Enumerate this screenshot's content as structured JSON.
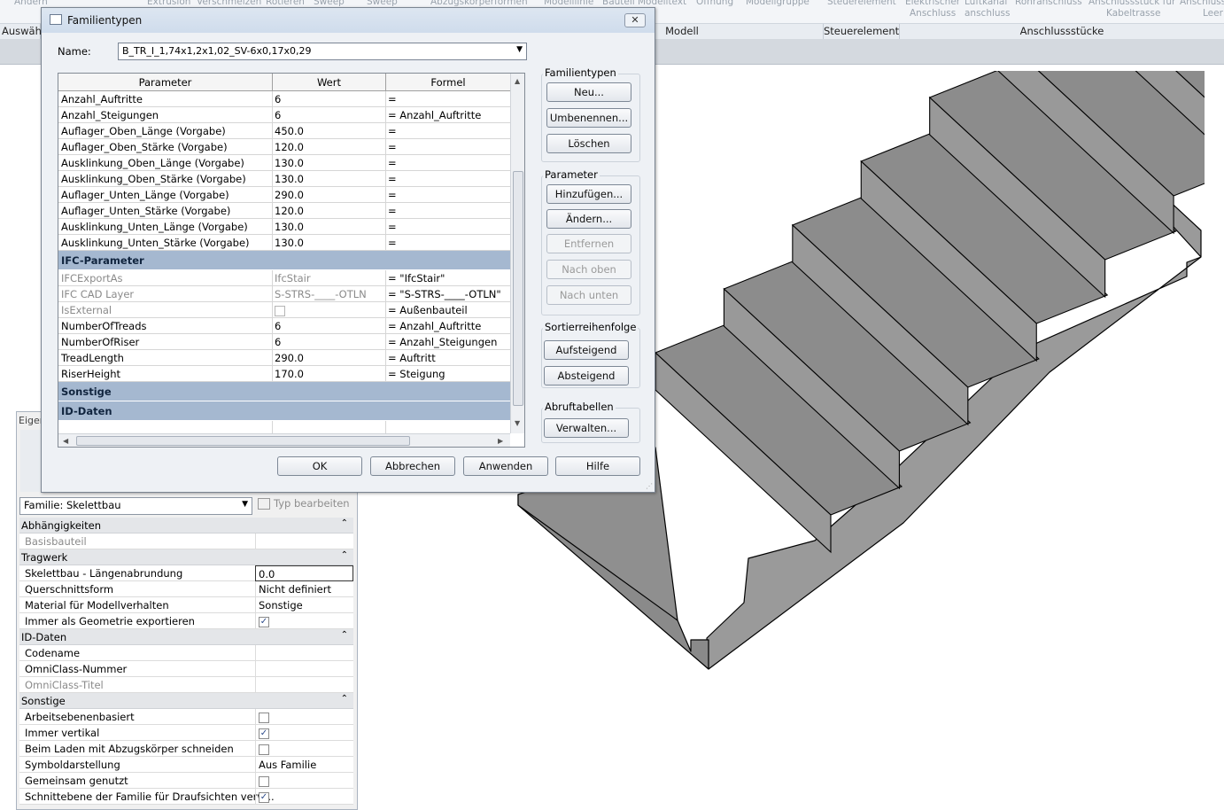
{
  "ribbon": {
    "top_items": [
      "Ändern",
      "Extrusion",
      "Verschmelzen",
      "Rotieren",
      "Sweep",
      "Sweep",
      "Abzugskörperformen",
      "Modelllinie",
      "Bauteil",
      "Modelltext",
      "Öffnung",
      "Modellgruppe",
      "Steuerelement",
      "Elektrischer",
      "Luftkanal",
      "Rohranschluss",
      "Anschlussstück für",
      "Anschluss",
      "Leer"
    ],
    "second_items": [
      "Anschluss",
      "anschluss",
      "Kabeltrasse",
      "Leer"
    ],
    "groups": [
      "Auswähle",
      "Modell",
      "Steuerelement",
      "Anschlussstücke"
    ]
  },
  "dialog": {
    "title": "Familientypen",
    "close_glyph": "✕",
    "name_label": "Name:",
    "name_value": "B_TR_I_1,74x1,2x1,02_SV-6x0,17x0,29",
    "columns": [
      "Parameter",
      "Wert",
      "Formel"
    ],
    "rows_a": [
      {
        "p": "Anzahl_Auftritte",
        "w": "6",
        "f": "="
      },
      {
        "p": "Anzahl_Steigungen",
        "w": "6",
        "f": "= Anzahl_Auftritte"
      },
      {
        "p": "Auflager_Oben_Länge (Vorgabe)",
        "w": "450.0",
        "f": "="
      },
      {
        "p": "Auflager_Oben_Stärke (Vorgabe)",
        "w": "120.0",
        "f": "="
      },
      {
        "p": "Ausklinkung_Oben_Länge (Vorgabe)",
        "w": "130.0",
        "f": "="
      },
      {
        "p": "Ausklinkung_Oben_Stärke (Vorgabe)",
        "w": "130.0",
        "f": "="
      },
      {
        "p": "Auflager_Unten_Länge (Vorgabe)",
        "w": "290.0",
        "f": "="
      },
      {
        "p": "Auflager_Unten_Stärke (Vorgabe)",
        "w": "120.0",
        "f": "="
      },
      {
        "p": "Ausklinkung_Unten_Länge (Vorgabe)",
        "w": "130.0",
        "f": "="
      },
      {
        "p": "Ausklinkung_Unten_Stärke (Vorgabe)",
        "w": "130.0",
        "f": "="
      }
    ],
    "section_ifc": "IFC-Parameter",
    "rows_ifc": [
      {
        "p": "IFCExportAs",
        "w": "IfcStair",
        "f": "= \"IfcStair\""
      },
      {
        "p": "IFC CAD Layer",
        "w": "S-STRS-____-OTLN",
        "f": "= \"S-STRS-____-OTLN\""
      },
      {
        "p": "IsExternal",
        "w": "",
        "f": "= Außenbauteil"
      }
    ],
    "rows_b": [
      {
        "p": "NumberOfTreads",
        "w": "6",
        "f": "= Anzahl_Auftritte"
      },
      {
        "p": "NumberOfRiser",
        "w": "6",
        "f": "= Anzahl_Steigungen"
      },
      {
        "p": "TreadLength",
        "w": "290.0",
        "f": "= Auftritt"
      },
      {
        "p": "RiserHeight",
        "w": "170.0",
        "f": "= Steigung"
      }
    ],
    "section_sonstige": "Sonstige",
    "section_id": "ID-Daten",
    "group_familientypen": "Familientypen",
    "btn_neu": "Neu...",
    "btn_umbenennen": "Umbenennen...",
    "btn_loeschen": "Löschen",
    "group_parameter": "Parameter",
    "btn_hinzufuegen": "Hinzufügen...",
    "btn_aendern": "Ändern...",
    "btn_entfernen": "Entfernen",
    "btn_nach_oben": "Nach oben",
    "btn_nach_unten": "Nach unten",
    "group_sort": "Sortierreihenfolge",
    "btn_aufsteigend": "Aufsteigend",
    "btn_absteigend": "Absteigend",
    "group_abruf": "Abruftabellen",
    "btn_verwalten": "Verwalten...",
    "btn_ok": "OK",
    "btn_abbrechen": "Abbrechen",
    "btn_anwenden": "Anwenden",
    "btn_hilfe": "Hilfe"
  },
  "properties": {
    "title": "Eigen",
    "family_select": "Familie: Skelettbau",
    "type_edit": "Typ bearbeiten",
    "sections": [
      {
        "label": "Abhängigkeiten",
        "rows": [
          {
            "label": "Basisbauteil",
            "value": "",
            "kind": "text",
            "grey": true
          }
        ]
      },
      {
        "label": "Tragwerk",
        "rows": [
          {
            "label": "Skelettbau  - Längenabrundung",
            "value": "0.0",
            "kind": "edit"
          },
          {
            "label": "Querschnittsform",
            "value": "Nicht definiert",
            "kind": "text"
          },
          {
            "label": "Material für Modellverhalten",
            "value": "Sonstige",
            "kind": "text"
          },
          {
            "label": "Immer als Geometrie exportieren",
            "value": "checked",
            "kind": "check"
          }
        ]
      },
      {
        "label": "ID-Daten",
        "rows": [
          {
            "label": "Codename",
            "value": "",
            "kind": "text"
          },
          {
            "label": "OmniClass-Nummer",
            "value": "",
            "kind": "text"
          },
          {
            "label": "OmniClass-Titel",
            "value": "",
            "kind": "text",
            "grey": true
          }
        ]
      },
      {
        "label": "Sonstige",
        "rows": [
          {
            "label": "Arbeitsebenenbasiert",
            "value": "unchecked",
            "kind": "check"
          },
          {
            "label": "Immer vertikal",
            "value": "checked",
            "kind": "check"
          },
          {
            "label": "Beim Laden mit Abzugskörper schneiden",
            "value": "unchecked",
            "kind": "check"
          },
          {
            "label": "Symboldarstellung",
            "value": "Aus Familie",
            "kind": "text"
          },
          {
            "label": "Gemeinsam genutzt",
            "value": "unchecked",
            "kind": "check"
          },
          {
            "label": "Schnittebene der Familie für Draufsichten verw...",
            "value": "checked",
            "kind": "check"
          }
        ]
      }
    ]
  },
  "colors": {
    "section_header": "#a5b8d0",
    "stair_top": "#8c8c8c",
    "stair_side": "#999999",
    "stair_edge": "#000000"
  }
}
